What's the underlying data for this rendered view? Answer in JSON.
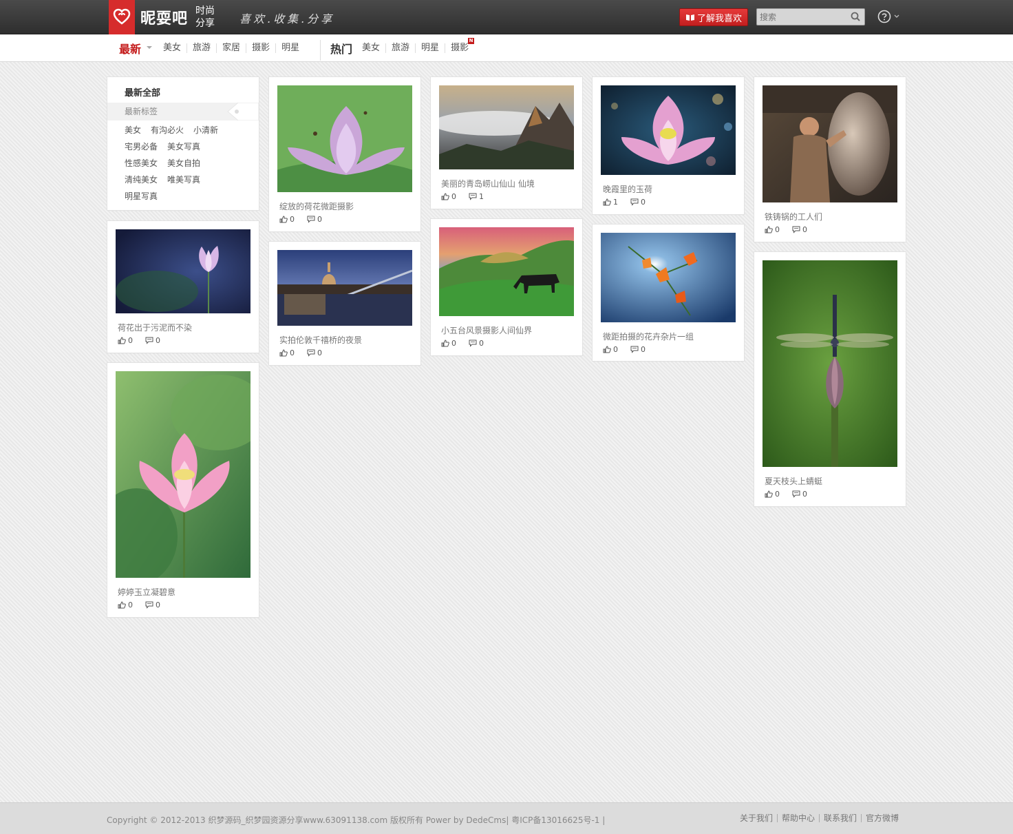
{
  "header": {
    "logo_text": "昵耍吧",
    "logo_sub": "时尚分享",
    "slogan": "喜欢.收集.分享",
    "like_button": "了解我喜欢",
    "search_placeholder": "搜索"
  },
  "nav": {
    "latest": {
      "title": "最新",
      "items": [
        "美女",
        "旅游",
        "家居",
        "摄影",
        "明星"
      ]
    },
    "hot": {
      "title": "热门",
      "items": [
        "美女",
        "旅游",
        "明星",
        "摄影"
      ],
      "badge": "N"
    }
  },
  "tags": {
    "title": "最新全部",
    "subtitle": "最新标签",
    "rows": [
      [
        "美女",
        "有沟必火",
        "小清新"
      ],
      [
        "宅男必备",
        "美女写真"
      ],
      [
        "性感美女",
        "美女自拍"
      ],
      [
        "清纯美女",
        "唯美写真"
      ],
      [
        "明星写真"
      ]
    ]
  },
  "cards": [
    {
      "caption": "荷花出于污泥而不染",
      "likes": "0",
      "comments": "0"
    },
    {
      "caption": "婷婷玉立凝碧意",
      "likes": "0",
      "comments": "0"
    },
    {
      "caption": "绽放的荷花微距摄影",
      "likes": "0",
      "comments": "0"
    },
    {
      "caption": "实拍伦敦千禧桥的夜景",
      "likes": "0",
      "comments": "0"
    },
    {
      "caption": "美丽的青岛崂山仙山 仙境",
      "likes": "0",
      "comments": "1"
    },
    {
      "caption": "小五台风景摄影人间仙界",
      "likes": "0",
      "comments": "0"
    },
    {
      "caption": "晚霞里的玉荷",
      "likes": "1",
      "comments": "0"
    },
    {
      "caption": "微距拍摄的花卉杂片一组",
      "likes": "0",
      "comments": "0"
    },
    {
      "caption": "铁铸锅的工人们",
      "likes": "0",
      "comments": "0"
    },
    {
      "caption": "夏天枝头上蜻蜓",
      "likes": "0",
      "comments": "0"
    }
  ],
  "footer": {
    "copyright": "Copyright © 2012-2013 织梦源码_织梦园资源分享www.63091138.com 版权所有 Power by DedeCms| 粤ICP备13016625号-1 |",
    "links": [
      "关于我们",
      "帮助中心",
      "联系我们",
      "官方微博"
    ]
  },
  "colors": {
    "brand_red": "#d62c2c",
    "topbar": "#3a3a3a"
  }
}
